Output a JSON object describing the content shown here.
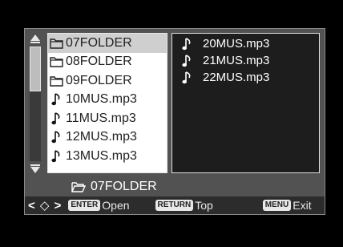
{
  "left_list": [
    {
      "type": "folder",
      "label": "07FOLDER",
      "selected": true
    },
    {
      "type": "folder",
      "label": "08FOLDER",
      "selected": false
    },
    {
      "type": "folder",
      "label": "09FOLDER",
      "selected": false
    },
    {
      "type": "music",
      "label": "10MUS.mp3",
      "selected": false
    },
    {
      "type": "music",
      "label": "11MUS.mp3",
      "selected": false
    },
    {
      "type": "music",
      "label": "12MUS.mp3",
      "selected": false
    },
    {
      "type": "music",
      "label": "13MUS.mp3",
      "selected": false
    }
  ],
  "right_list": [
    "20MUS.mp3",
    "21MUS.mp3",
    "22MUS.mp3"
  ],
  "current_folder": "07FOLDER",
  "help": {
    "nav_symbols": "< ◇ >",
    "enter_key": "ENTER",
    "enter_label": "Open",
    "return_key": "RETURN",
    "return_label": "Top",
    "menu_key": "MENU",
    "menu_label": "Exit"
  },
  "scroll_position": 0.0
}
